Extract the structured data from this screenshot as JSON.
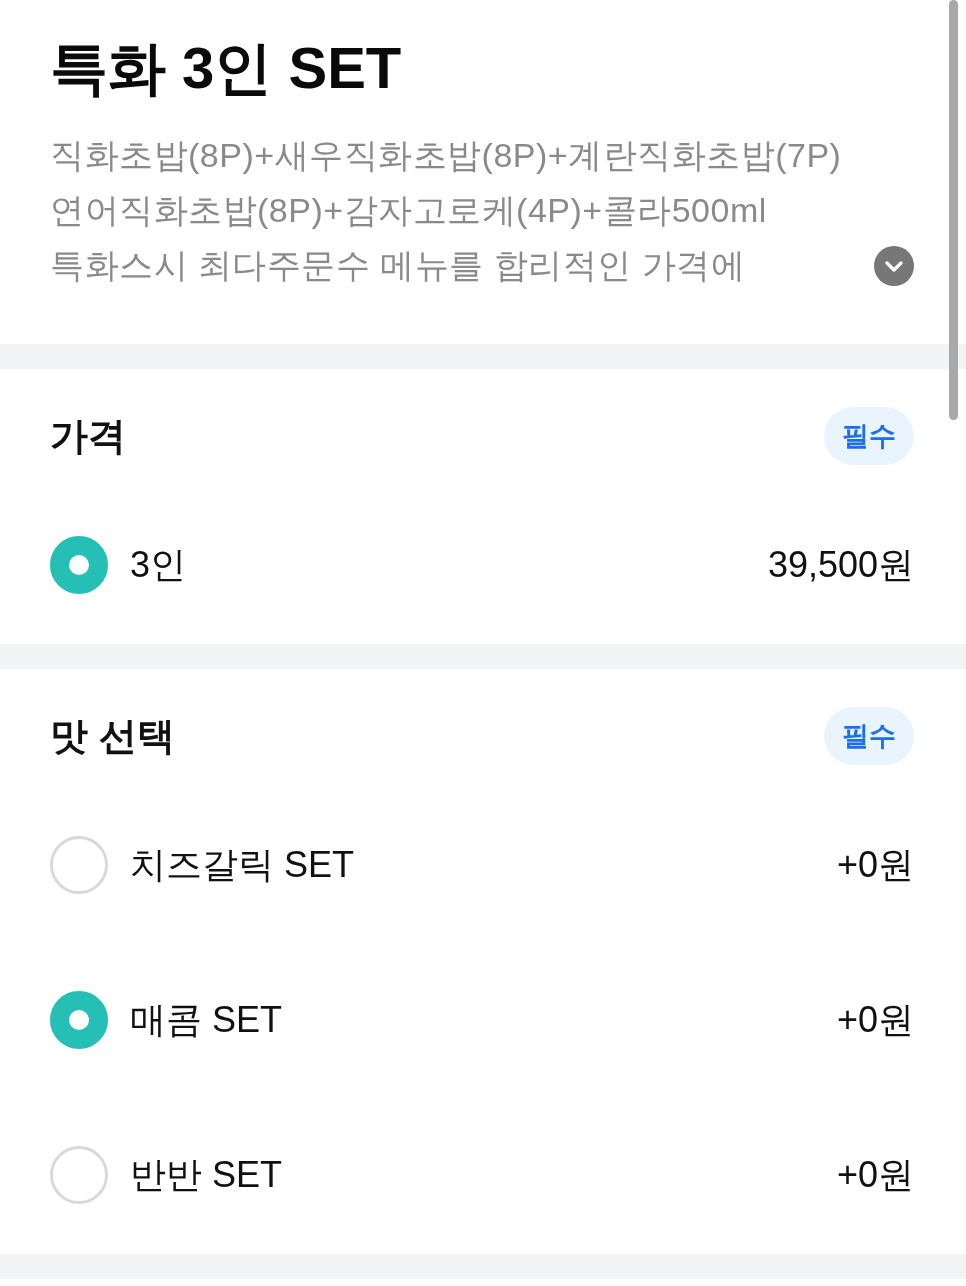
{
  "product": {
    "title": "특화 3인 SET",
    "description_lines": [
      "직화초밥(8P)+새우직화초밥(8P)+계란직화초밥(7P)",
      "연어직화초밥(8P)+감자고로케(4P)+콜라500ml",
      "특화스시 최다주문수 메뉴를 합리적인 가격에"
    ],
    "expanded": false
  },
  "option_groups": [
    {
      "title": "가격",
      "badge": "필수",
      "options": [
        {
          "label": "3인",
          "price": "39,500원",
          "selected": true
        }
      ]
    },
    {
      "title": "맛 선택",
      "badge": "필수",
      "options": [
        {
          "label": "치즈갈릭 SET",
          "price": "+0원",
          "selected": false
        },
        {
          "label": "매콤 SET",
          "price": "+0원",
          "selected": true
        },
        {
          "label": "반반 SET",
          "price": "+0원",
          "selected": false
        }
      ]
    }
  ]
}
